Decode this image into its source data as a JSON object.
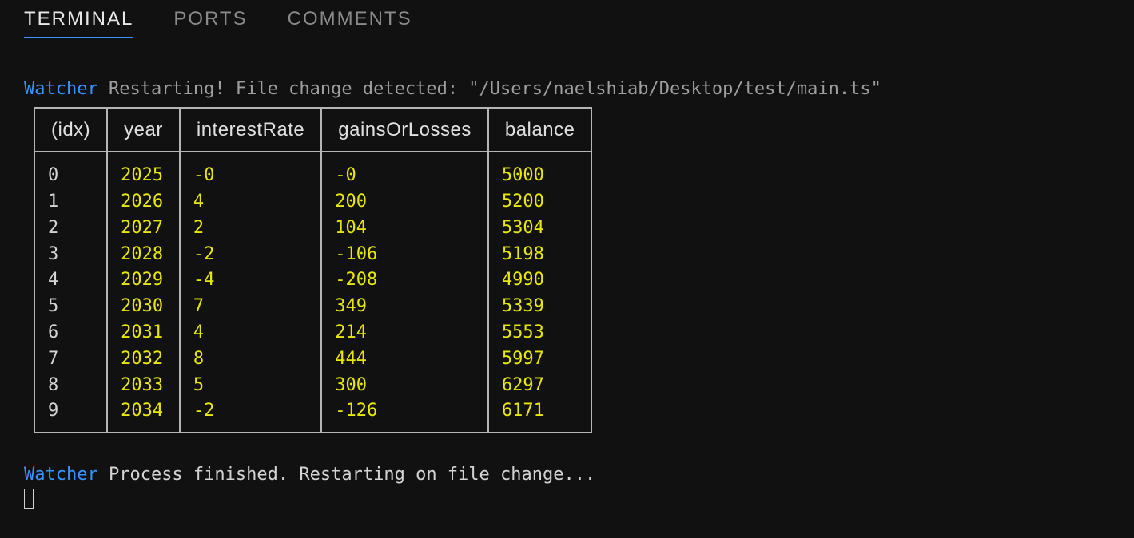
{
  "tabs": {
    "terminal": "TERMINAL",
    "ports": "PORTS",
    "comments": "COMMENTS"
  },
  "log1": {
    "prefix": "Watcher",
    "text": " Restarting! File change detected: \"/Users/naelshiab/Desktop/test/main.ts\""
  },
  "table": {
    "headers": {
      "idx": "(idx)",
      "year": "year",
      "interestRate": "interestRate",
      "gainsOrLosses": "gainsOrLosses",
      "balance": "balance"
    },
    "rows": [
      {
        "idx": "0",
        "year": "2025",
        "interestRate": "-0",
        "gainsOrLosses": "-0",
        "balance": "5000"
      },
      {
        "idx": "1",
        "year": "2026",
        "interestRate": "4",
        "gainsOrLosses": "200",
        "balance": "5200"
      },
      {
        "idx": "2",
        "year": "2027",
        "interestRate": "2",
        "gainsOrLosses": "104",
        "balance": "5304"
      },
      {
        "idx": "3",
        "year": "2028",
        "interestRate": "-2",
        "gainsOrLosses": "-106",
        "balance": "5198"
      },
      {
        "idx": "4",
        "year": "2029",
        "interestRate": "-4",
        "gainsOrLosses": "-208",
        "balance": "4990"
      },
      {
        "idx": "5",
        "year": "2030",
        "interestRate": "7",
        "gainsOrLosses": "349",
        "balance": "5339"
      },
      {
        "idx": "6",
        "year": "2031",
        "interestRate": "4",
        "gainsOrLosses": "214",
        "balance": "5553"
      },
      {
        "idx": "7",
        "year": "2032",
        "interestRate": "8",
        "gainsOrLosses": "444",
        "balance": "5997"
      },
      {
        "idx": "8",
        "year": "2033",
        "interestRate": "5",
        "gainsOrLosses": "300",
        "balance": "6297"
      },
      {
        "idx": "9",
        "year": "2034",
        "interestRate": "-2",
        "gainsOrLosses": "-126",
        "balance": "6171"
      }
    ]
  },
  "log2": {
    "prefix": "Watcher",
    "text": " Process finished. Restarting on file change..."
  }
}
